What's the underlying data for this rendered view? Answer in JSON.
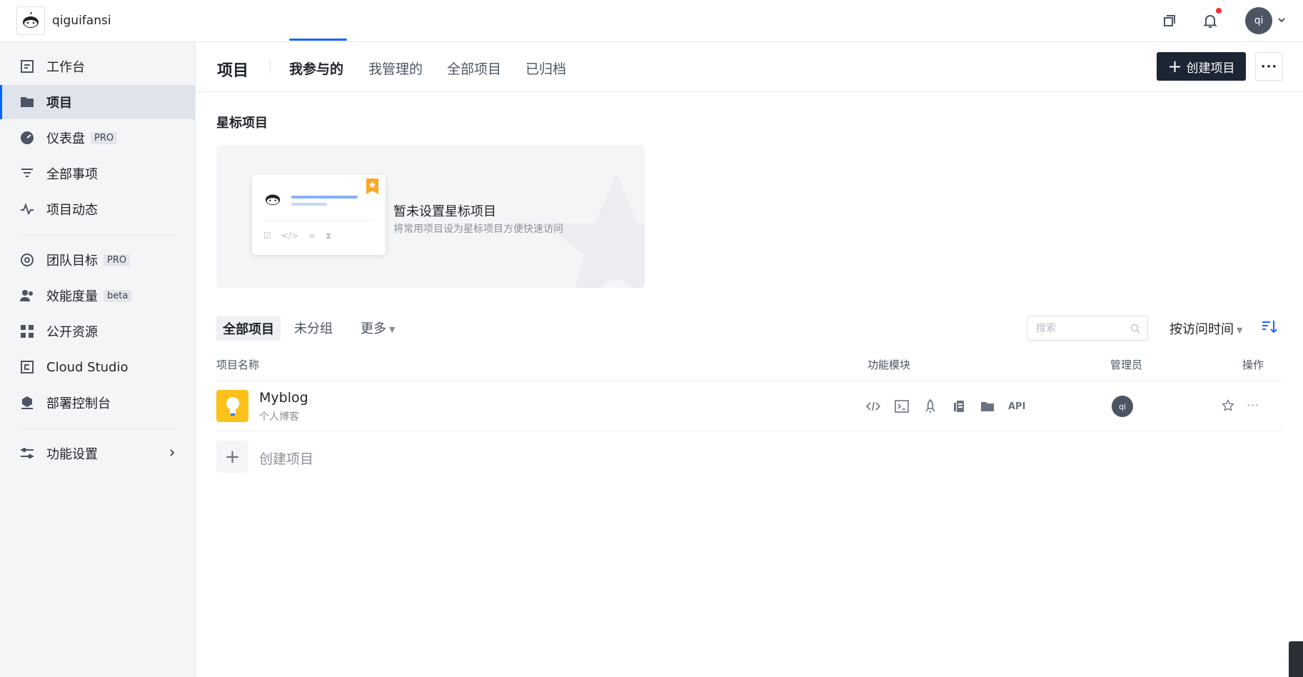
{
  "topbar": {
    "team_name": "qiguifansi",
    "avatar_initials": "qi",
    "icons": [
      "copy-icon",
      "bell-icon",
      "chevron-down-icon"
    ],
    "notification_dot_color": "#f22c3d"
  },
  "sidebar": {
    "items": [
      {
        "label": "工作台",
        "icon": "workbench-icon"
      },
      {
        "label": "项目",
        "icon": "folder-icon",
        "active": true
      },
      {
        "label": "仪表盘",
        "icon": "dashboard-icon",
        "badge": "PRO"
      },
      {
        "label": "全部事项",
        "icon": "filter-icon"
      },
      {
        "label": "项目动态",
        "icon": "activity-icon"
      },
      {
        "label": "团队目标",
        "icon": "target-icon",
        "badge": "PRO"
      },
      {
        "label": "效能度量",
        "icon": "users-icon",
        "badge": "beta"
      },
      {
        "label": "公开资源",
        "icon": "grid-icon"
      },
      {
        "label": "Cloud Studio",
        "icon": "cloud-studio-icon"
      },
      {
        "label": "部署控制台",
        "icon": "deploy-icon"
      },
      {
        "label": "功能设置",
        "icon": "settings-sliders-icon"
      }
    ]
  },
  "header": {
    "title": "项目",
    "tabs": [
      "我参与的",
      "我管理的",
      "全部项目",
      "已归档"
    ],
    "active_tab": "我参与的",
    "create_label": "创建项目",
    "more_label": "···"
  },
  "starred": {
    "title": "星标项目",
    "empty_title": "暂未设置星标项目",
    "empty_desc": "将常用项目设为星标项目方便快速访问"
  },
  "filters": {
    "tabs": [
      "全部项目",
      "未分组",
      "更多"
    ],
    "search_placeholder": "搜索",
    "sort_label": "按访问时间"
  },
  "table": {
    "columns": [
      "项目名称",
      "功能模块",
      "管理员",
      "操作"
    ],
    "rows": [
      {
        "name": "Myblog",
        "desc": "个人博客",
        "modules": [
          "code-icon",
          "terminal-icon",
          "rocket-icon",
          "doc-icon",
          "folder-icon",
          "API"
        ],
        "admin_initials": "qi"
      }
    ],
    "create_label": "创建项目"
  },
  "colors": {
    "accent": "#1a66ff",
    "primary_button": "#1c2533",
    "project_icon_bg": "#fcc21b"
  }
}
